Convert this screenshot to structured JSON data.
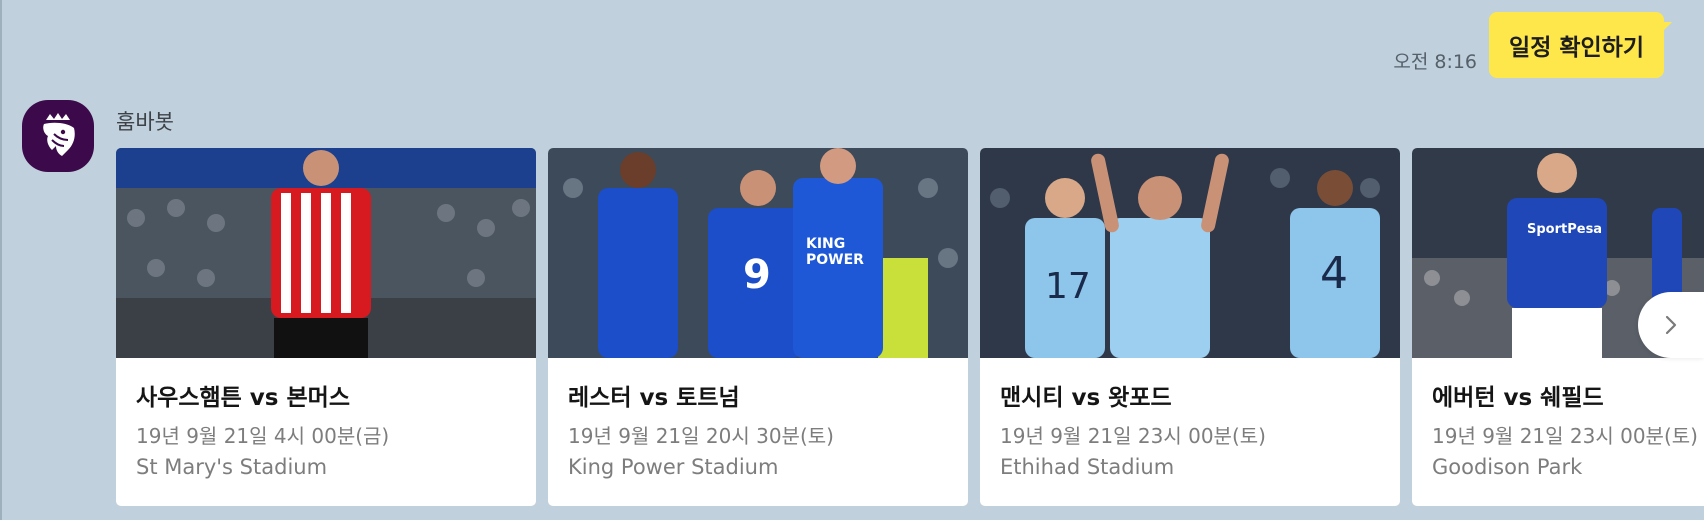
{
  "outgoing": {
    "time": "오전 8:16",
    "text": "일정 확인하기"
  },
  "bot": {
    "name": "훔바봇",
    "avatar_icon": "premier-league-lion-icon"
  },
  "cards": [
    {
      "match": "사우스햄튼 vs 본머스",
      "datetime": "19년 9월 21일 4시 00분(금)",
      "stadium": "St Mary's Stadium",
      "photo": "southampton-player-photo",
      "kit_colors": [
        "#d71920",
        "#ffffff"
      ]
    },
    {
      "match": "레스터 vs 토트넘",
      "datetime": "19년 9월 21일 20시 30분(토)",
      "stadium": "King Power Stadium",
      "photo": "leicester-players-photo",
      "kit_colors": [
        "#1b4ec8",
        "#ffffff"
      ]
    },
    {
      "match": "맨시티 vs 왓포드",
      "datetime": "19년 9월 21일 23시 00분(토)",
      "stadium": "Ethihad Stadium",
      "photo": "man-city-players-photo",
      "kit_colors": [
        "#8ec5ea",
        "#ffffff"
      ]
    },
    {
      "match": "에버턴 vs 쉐필드",
      "datetime": "19년 9월 21일 23시 00분(토)",
      "stadium": "Goodison Park",
      "photo": "everton-players-photo",
      "kit_colors": [
        "#1f47b8",
        "#ffffff"
      ]
    }
  ],
  "carousel": {
    "next_icon": "chevron-right-icon"
  }
}
